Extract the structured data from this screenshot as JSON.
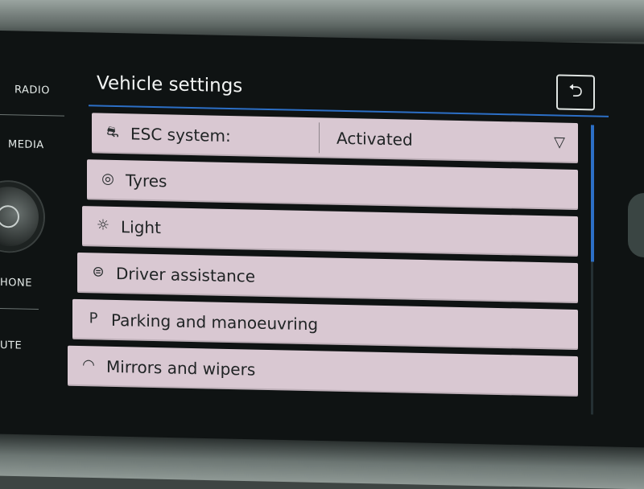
{
  "side_menu": {
    "radio": "RADIO",
    "media": "MEDIA",
    "phone": "HONE",
    "mute": "UTE"
  },
  "header": {
    "title": "Vehicle settings",
    "back_symbol": "⮌"
  },
  "settings": {
    "esc": {
      "label": "ESC system:",
      "value": "Activated",
      "icon": "esc-icon"
    },
    "items": [
      {
        "label": "Tyres",
        "icon": "tyre-icon"
      },
      {
        "label": "Light",
        "icon": "light-icon"
      },
      {
        "label": "Driver assistance",
        "icon": "driver-assistance-icon"
      },
      {
        "label": "Parking and manoeuvring",
        "icon": "parking-icon"
      },
      {
        "label": "Mirrors and wipers",
        "icon": "wiper-icon"
      }
    ]
  },
  "colors": {
    "accent": "#2c6fc6",
    "row_background": "#d9c8d2",
    "screen_background": "#0f1313"
  }
}
